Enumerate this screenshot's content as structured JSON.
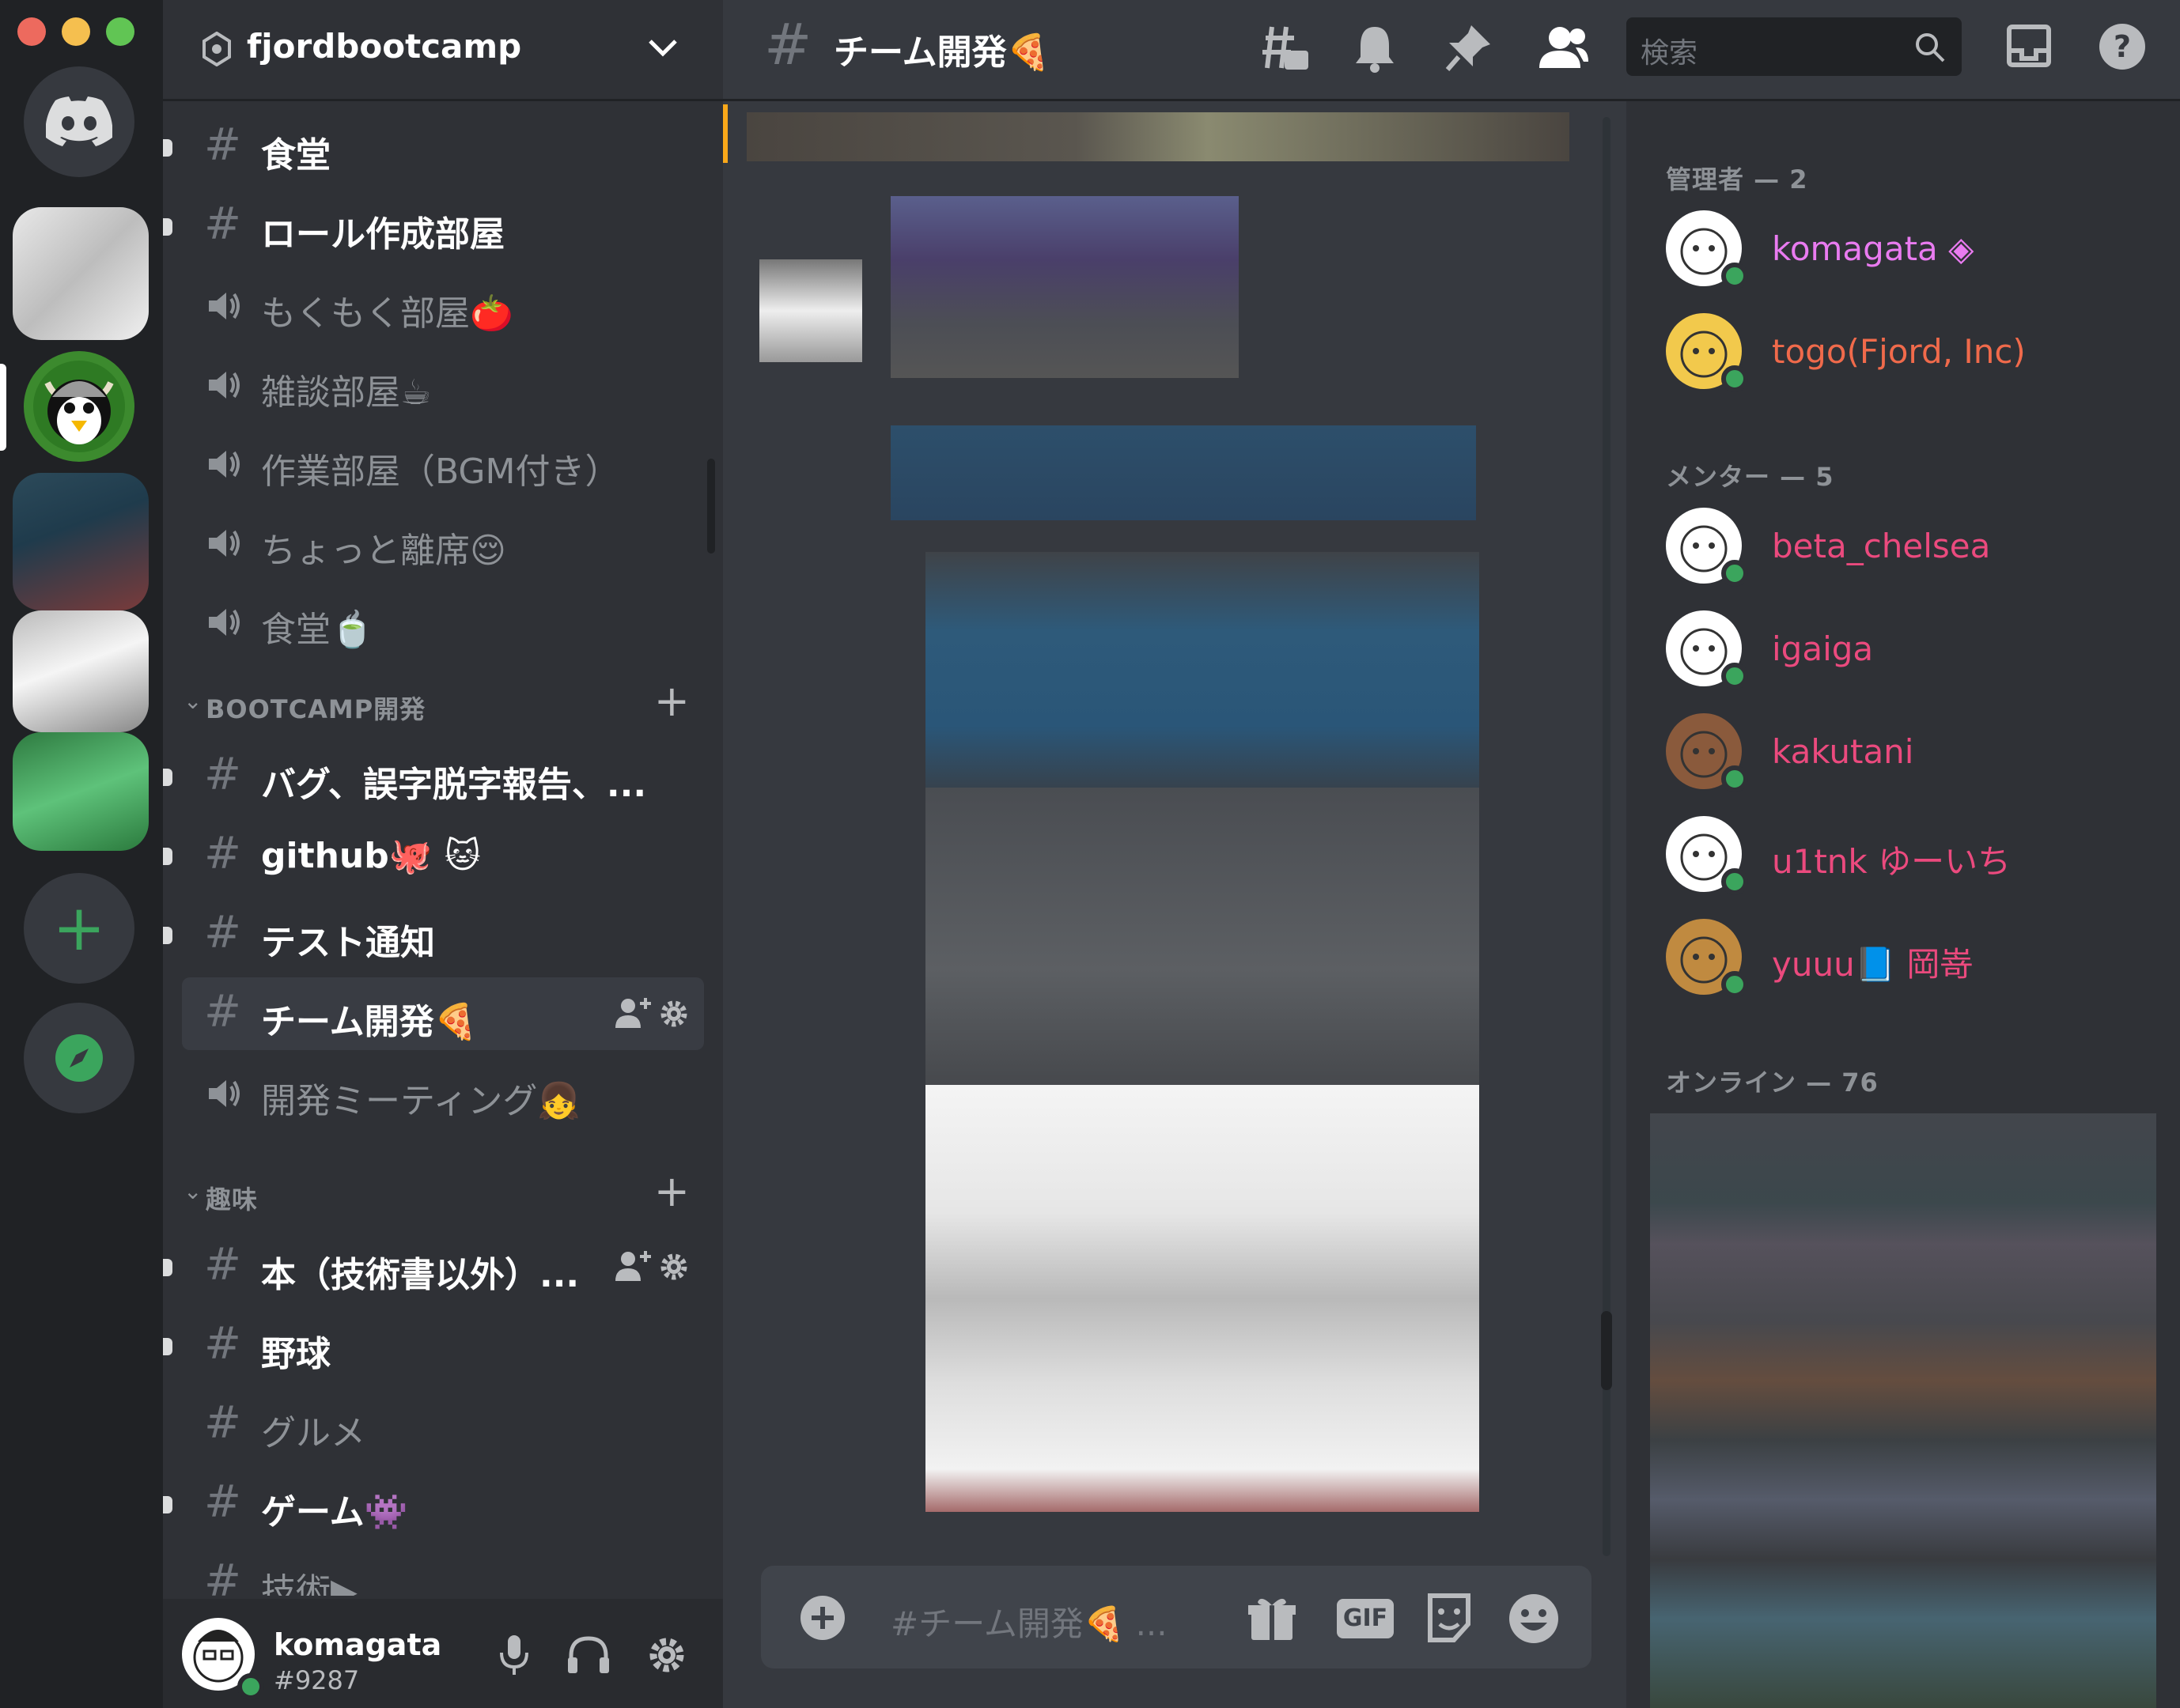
{
  "window": {
    "traffic_colors": [
      "#ed6a5e",
      "#f5bf4f",
      "#61c554"
    ]
  },
  "colors": {
    "accent": "#5865f2",
    "online": "#3ba55d",
    "admin": "#e97bf0",
    "admin2": "#f06a4b",
    "mentor": "#eb4a7e",
    "green_action": "#3ba55d"
  },
  "server": {
    "name": "fjordbootcamp"
  },
  "channels_top": [
    {
      "type": "text",
      "label": "食堂",
      "unread": true
    },
    {
      "type": "text",
      "label": "ロール作成部屋",
      "unread": true
    },
    {
      "type": "voice",
      "label": "もくもく部屋🍅"
    },
    {
      "type": "voice",
      "label": "雑談部屋☕"
    },
    {
      "type": "voice",
      "label": "作業部屋（BGM付き）"
    },
    {
      "type": "voice",
      "label": "ちょっと離席😌"
    },
    {
      "type": "voice",
      "label": "食堂🍵"
    }
  ],
  "category_dev": {
    "label": "BOOTCAMP開発"
  },
  "channels_dev": [
    {
      "type": "text",
      "label": "バグ、誤字脱字報告、...",
      "unread": true
    },
    {
      "type": "text",
      "label": "github🐙 🐱",
      "unread": true
    },
    {
      "type": "text",
      "label": "テスト通知",
      "unread": true
    },
    {
      "type": "text",
      "label": "チーム開発🍕",
      "selected": true
    },
    {
      "type": "voice",
      "label": "開発ミーティング👧"
    }
  ],
  "category_hobby": {
    "label": "趣味"
  },
  "channels_hobby": [
    {
      "type": "text",
      "label": "本（技術書以外）...",
      "unread": true
    },
    {
      "type": "text",
      "label": "野球",
      "unread": true
    },
    {
      "type": "text",
      "label": "グルメ"
    },
    {
      "type": "text",
      "label": "ゲーム👾",
      "unread": true
    },
    {
      "type": "text",
      "label": "技術▶"
    }
  ],
  "user": {
    "name": "komagata",
    "tag": "#9287"
  },
  "topbar": {
    "channel": "チーム開発🍕",
    "search_placeholder": "検索"
  },
  "composer": {
    "placeholder": "#チーム開発🍕 ...",
    "gif_label": "GIF"
  },
  "members": {
    "admin_header": "管理者 — 2",
    "admins": [
      {
        "name": "komagata ◈",
        "color": "#e97bf0"
      },
      {
        "name": "togo(Fjord, Inc)",
        "color": "#f06a4b"
      }
    ],
    "mentor_header": "メンター — 5",
    "mentors": [
      {
        "name": "beta_chelsea"
      },
      {
        "name": "igaiga"
      },
      {
        "name": "kakutani"
      },
      {
        "name": "u1tnk ゆーいち"
      },
      {
        "name": "yuuu📘 岡嵜"
      }
    ],
    "online_header": "オンライン — 76"
  }
}
